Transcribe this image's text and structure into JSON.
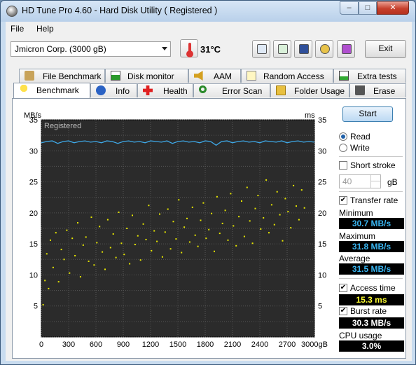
{
  "window": {
    "title": "HD Tune Pro 4.60 - Hard Disk Utility (  Registered )",
    "min_glyph": "–",
    "max_glyph": "□",
    "close_glyph": "✕"
  },
  "menu": {
    "file": "File",
    "help": "Help"
  },
  "toolbar": {
    "drive": "Jmicron Corp. (3000 gB)",
    "temperature": "31°C",
    "exit_label": "Exit"
  },
  "tabs_top": [
    {
      "label": "File Benchmark",
      "icon": "file-benchmark-icon"
    },
    {
      "label": "Disk monitor",
      "icon": "disk-monitor-icon"
    },
    {
      "label": "AAM",
      "icon": "speaker-icon"
    },
    {
      "label": "Random Access",
      "icon": "random-access-icon"
    },
    {
      "label": "Extra tests",
      "icon": "extra-tests-icon"
    }
  ],
  "tabs_bottom": [
    {
      "label": "Benchmark",
      "icon": "benchmark-icon"
    },
    {
      "label": "Info",
      "icon": "info-icon"
    },
    {
      "label": "Health",
      "icon": "health-icon"
    },
    {
      "label": "Error Scan",
      "icon": "magnifier-icon"
    },
    {
      "label": "Folder Usage",
      "icon": "folder-icon"
    },
    {
      "label": "Erase",
      "icon": "trash-icon"
    }
  ],
  "controls": {
    "start_label": "Start",
    "read_label": "Read",
    "write_label": "Write",
    "mode_selected": "Read",
    "short_stroke_label": "Short stroke",
    "short_stroke_checked": false,
    "short_stroke_value": "40",
    "short_stroke_unit": "gB",
    "transfer_rate_label": "Transfer rate",
    "transfer_rate_checked": true,
    "access_time_label": "Access time",
    "access_time_checked": true,
    "burst_rate_label": "Burst rate",
    "burst_rate_checked": true
  },
  "stats": {
    "minimum_label": "Minimum",
    "minimum_value": "30.7 MB/s",
    "maximum_label": "Maximum",
    "maximum_value": "31.8 MB/s",
    "average_label": "Average",
    "average_value": "31.5 MB/s",
    "access_time_value": "15.3 ms",
    "burst_rate_value": "30.3 MB/s",
    "cpu_usage_label": "CPU usage",
    "cpu_usage_value": "3.0%"
  },
  "colors": {
    "transfer_line": "#3fa9e8",
    "access_points": "#e6e600",
    "value_blue": "#39b6f2",
    "value_yellow": "#ffff33",
    "value_white": "#ffffff",
    "chart_bg": "#2b2b2b"
  },
  "chart_data": {
    "type": "line+scatter",
    "watermark": "Registered",
    "y_left_label": "MB/s",
    "y_right_label": "ms",
    "x_unit": "gB",
    "xlim": [
      0,
      3000
    ],
    "ylim_left": [
      0,
      35
    ],
    "ylim_right": [
      0,
      35
    ],
    "x_ticks": [
      0,
      300,
      600,
      900,
      1200,
      1500,
      1800,
      2100,
      2400,
      2700,
      3000
    ],
    "x_tick_labels": [
      "0",
      "300",
      "600",
      "900",
      "1200",
      "1500",
      "1800",
      "2100",
      "2400",
      "2700",
      "3000gB"
    ],
    "y_ticks": [
      5,
      10,
      15,
      20,
      25,
      30,
      35
    ],
    "grid": true,
    "transfer_rate_mbs": {
      "x": [
        0,
        60,
        120,
        180,
        240,
        300,
        360,
        420,
        480,
        540,
        600,
        660,
        720,
        780,
        840,
        900,
        960,
        1020,
        1080,
        1140,
        1200,
        1260,
        1320,
        1380,
        1440,
        1500,
        1560,
        1620,
        1680,
        1740,
        1800,
        1860,
        1920,
        1980,
        2040,
        2100,
        2160,
        2220,
        2280,
        2340,
        2400,
        2460,
        2520,
        2580,
        2640,
        2700,
        2760,
        2820,
        2880,
        2940,
        3000
      ],
      "y": [
        31.3,
        31.5,
        31.6,
        31.2,
        31.5,
        31.6,
        31.3,
        31.5,
        31.6,
        31.4,
        31.5,
        31.3,
        31.6,
        31.5,
        31.2,
        31.5,
        31.6,
        31.4,
        31.5,
        31.3,
        31.6,
        31.5,
        31.4,
        31.6,
        31.2,
        31.5,
        31.6,
        31.4,
        31.5,
        31.3,
        31.6,
        31.5,
        30.9,
        31.5,
        31.6,
        31.3,
        31.5,
        31.6,
        31.4,
        31.5,
        31.3,
        31.6,
        31.5,
        31.4,
        31.6,
        31.3,
        31.5,
        31.6,
        31.4,
        31.5,
        31.4
      ]
    },
    "access_time_ms": {
      "x": [
        20,
        40,
        60,
        80,
        100,
        130,
        160,
        190,
        220,
        250,
        280,
        310,
        340,
        370,
        400,
        430,
        460,
        490,
        520,
        550,
        580,
        610,
        640,
        670,
        700,
        730,
        760,
        790,
        820,
        850,
        880,
        910,
        940,
        970,
        1000,
        1030,
        1060,
        1090,
        1120,
        1150,
        1180,
        1210,
        1240,
        1270,
        1300,
        1330,
        1360,
        1390,
        1420,
        1450,
        1480,
        1510,
        1540,
        1570,
        1600,
        1630,
        1660,
        1690,
        1720,
        1750,
        1780,
        1810,
        1840,
        1870,
        1900,
        1930,
        1960,
        1990,
        2020,
        2050,
        2080,
        2110,
        2140,
        2170,
        2200,
        2230,
        2260,
        2290,
        2320,
        2350,
        2380,
        2410,
        2440,
        2470,
        2500,
        2530,
        2560,
        2590,
        2620,
        2650,
        2680,
        2710,
        2740,
        2770,
        2800,
        2830,
        2860,
        2890
      ],
      "y": [
        5.2,
        9.1,
        13.4,
        7.8,
        15.6,
        11.2,
        16.8,
        8.9,
        14.1,
        12.5,
        17.2,
        10.3,
        15.9,
        13.1,
        18.4,
        9.7,
        14.8,
        16.1,
        12.2,
        19.3,
        11.6,
        15.2,
        17.8,
        13.7,
        10.9,
        18.9,
        14.4,
        16.6,
        12.8,
        20.1,
        15.1,
        13.3,
        17.5,
        11.8,
        19.6,
        14.9,
        16.3,
        12.4,
        18.2,
        15.7,
        21.2,
        13.9,
        17.1,
        15.4,
        19.8,
        12.9,
        16.9,
        20.6,
        14.2,
        18.6,
        15.8,
        22.1,
        13.6,
        17.7,
        19.1,
        15.3,
        20.9,
        16.4,
        14.6,
        18.8,
        21.6,
        15.9,
        17.3,
        19.9,
        13.8,
        22.6,
        16.7,
        18.3,
        20.4,
        15.6,
        23.1,
        17.9,
        14.7,
        19.4,
        21.9,
        16.2,
        24.1,
        18.7,
        15.1,
        20.7,
        22.8,
        17.4,
        19.2,
        25.3,
        16.8,
        21.3,
        18.1,
        23.4,
        19.7,
        15.5,
        22.3,
        20.2,
        17.6,
        24.4,
        21.1,
        18.9,
        23.7,
        20.8
      ]
    }
  }
}
